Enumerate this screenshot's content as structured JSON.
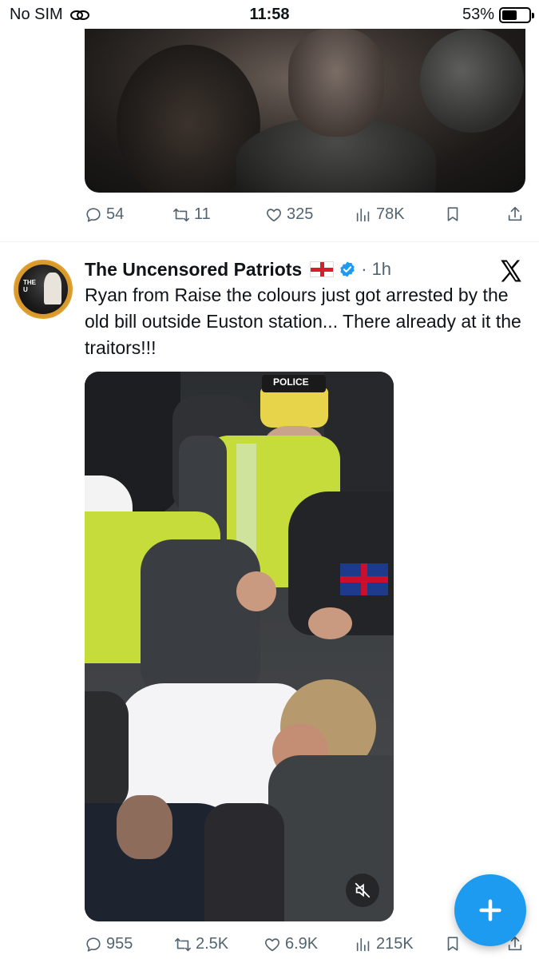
{
  "status_bar": {
    "carrier": "No SIM",
    "time": "11:58",
    "battery": "53%"
  },
  "tweet1": {
    "actions": {
      "replies": "54",
      "retweets": "11",
      "likes": "325",
      "views": "78K"
    }
  },
  "tweet2": {
    "author": "The Uncensored Patriots",
    "separator": "·",
    "time_ago": "1h",
    "text": "Ryan from Raise the colours just got arrested by the old bill outside Euston station... There already at it the traitors!!!",
    "media_badge": "POLICE",
    "actions": {
      "replies": "955",
      "retweets": "2.5K",
      "likes": "6.9K",
      "views": "215K"
    }
  },
  "icons": {
    "wifi": "link-wifi-icon",
    "reply": "speech-bubble-icon",
    "retweet": "retweet-icon",
    "like": "heart-icon",
    "views": "bar-chart-icon",
    "bookmark": "bookmark-icon",
    "share": "share-icon",
    "verified": "verified-badge-icon",
    "x": "x-logo-icon",
    "mute": "muted-speaker-icon",
    "compose": "plus-icon"
  },
  "colors": {
    "accent": "#1d9bf0",
    "muted_text": "#536471",
    "flag_red": "#d81e2c"
  }
}
